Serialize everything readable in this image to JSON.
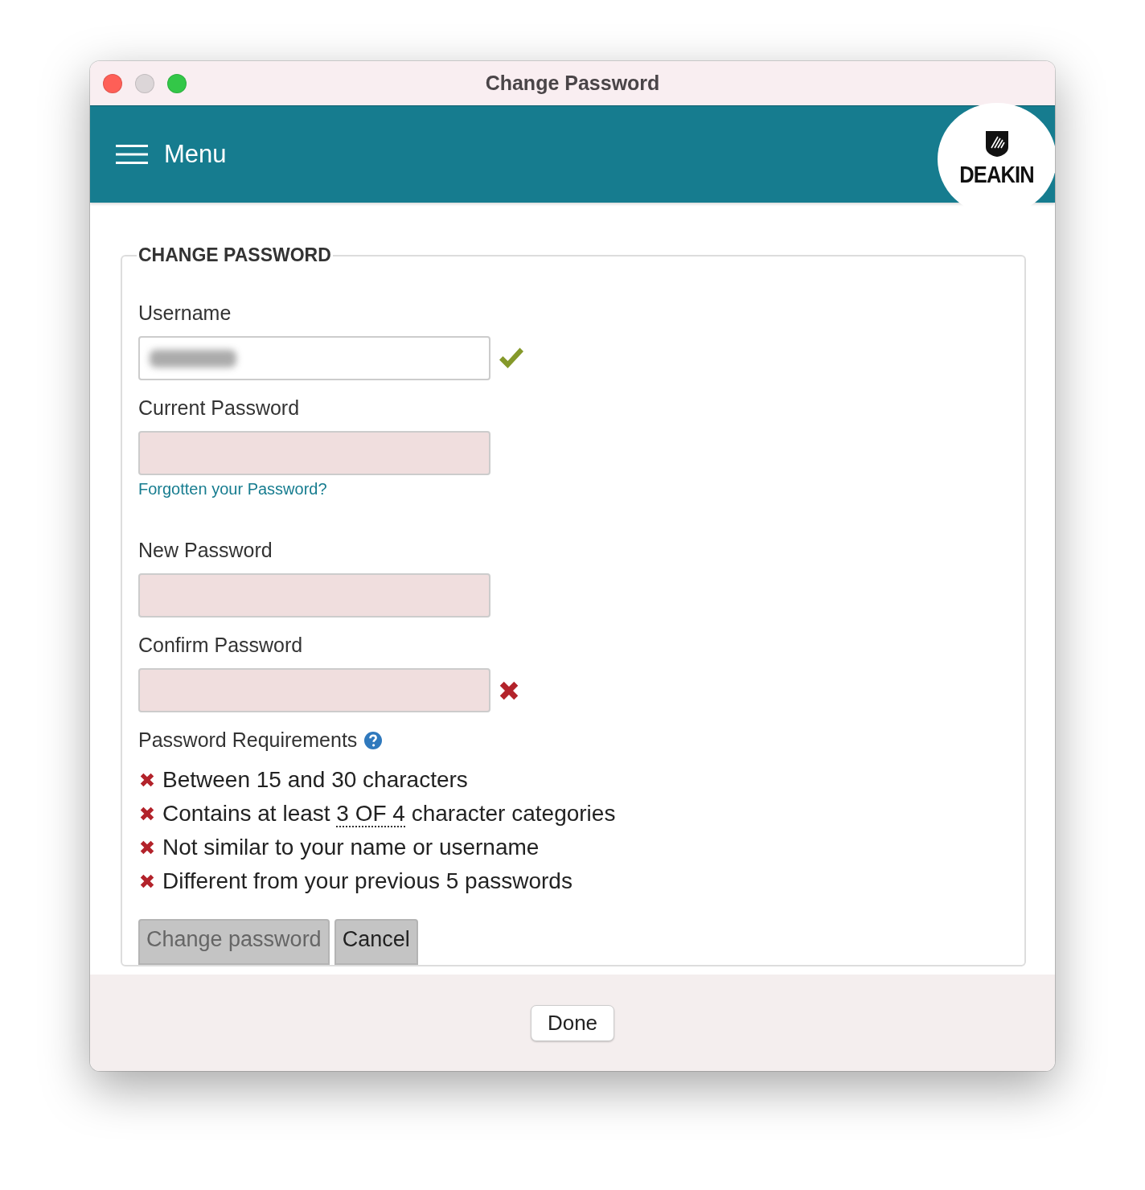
{
  "window": {
    "title": "Change Password",
    "controls": [
      {
        "kind": "close",
        "disabled": false
      },
      {
        "kind": "minimize",
        "disabled": true
      },
      {
        "kind": "zoom",
        "disabled": false
      }
    ]
  },
  "header": {
    "menu_label": "Menu",
    "logo_text": "DEAKIN"
  },
  "form": {
    "legend": "CHANGE PASSWORD",
    "fields": [
      {
        "label": "Username",
        "kind": "text",
        "value_blurred": true,
        "show_check": true,
        "show_cross": false
      },
      {
        "label": "Current Password",
        "kind": "password",
        "show_check": false,
        "show_cross": false,
        "link": "Forgotten your Password?"
      },
      {
        "label": "New Password",
        "kind": "password",
        "show_check": false,
        "show_cross": false
      },
      {
        "label": "Confirm Password",
        "kind": "password",
        "show_check": false,
        "show_cross": true
      }
    ],
    "requirements_title": "Password Requirements",
    "requirements": [
      {
        "text": "Between 15 and 30 characters",
        "met": false
      },
      {
        "text": "Contains at least ",
        "abbr": "3 OF 4",
        "after": " character categories",
        "met": false
      },
      {
        "text": "Not similar to your name or username",
        "met": false
      },
      {
        "text": "Different from your previous 5 passwords",
        "met": false
      }
    ],
    "buttons": [
      {
        "label": "Change password",
        "disabled": true
      },
      {
        "label": "Cancel",
        "disabled": false
      }
    ]
  },
  "footer": {
    "button": "Done"
  }
}
